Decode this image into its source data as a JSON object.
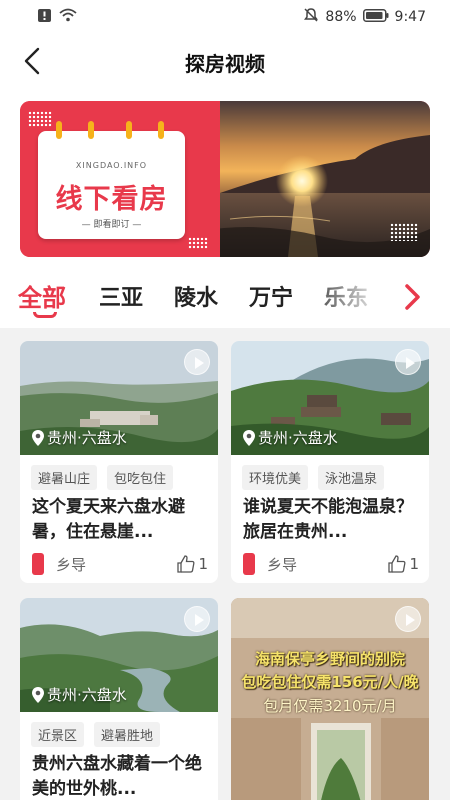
{
  "status_bar": {
    "battery": "88%",
    "time": "9:47"
  },
  "header": {
    "title": "探房视频"
  },
  "banner": {
    "site": "XINGDAO.INFO",
    "headline": "线下看房",
    "subtitle": "— 即看即订 —"
  },
  "tabs": [
    {
      "label": "全部",
      "active": true
    },
    {
      "label": "三亚"
    },
    {
      "label": "陵水"
    },
    {
      "label": "万宁"
    },
    {
      "label": "乐东"
    }
  ],
  "cards": [
    {
      "location": "贵州·六盘水",
      "tags": [
        "避暑山庄",
        "包吃包住"
      ],
      "title": "这个夏天来六盘水避暑，住在悬崖...",
      "author": "乡导",
      "likes": "1"
    },
    {
      "location": "贵州·六盘水",
      "tags": [
        "环境优美",
        "泳池温泉"
      ],
      "title": "谁说夏天不能泡温泉？旅居在贵州...",
      "author": "乡导",
      "likes": "1"
    },
    {
      "location": "贵州·六盘水",
      "tags": [
        "近景区",
        "避暑胜地"
      ],
      "title": "贵州六盘水藏着一个绝美的世外桃..."
    },
    {
      "overlay_line1": "海南保亭乡野间的别院",
      "overlay_line2": "包吃包住仅需156元/人/晚",
      "overlay_line3": "包月仅需3210元/月"
    }
  ],
  "colors": {
    "accent": "#e8394b",
    "background": "#f2f2f2"
  }
}
